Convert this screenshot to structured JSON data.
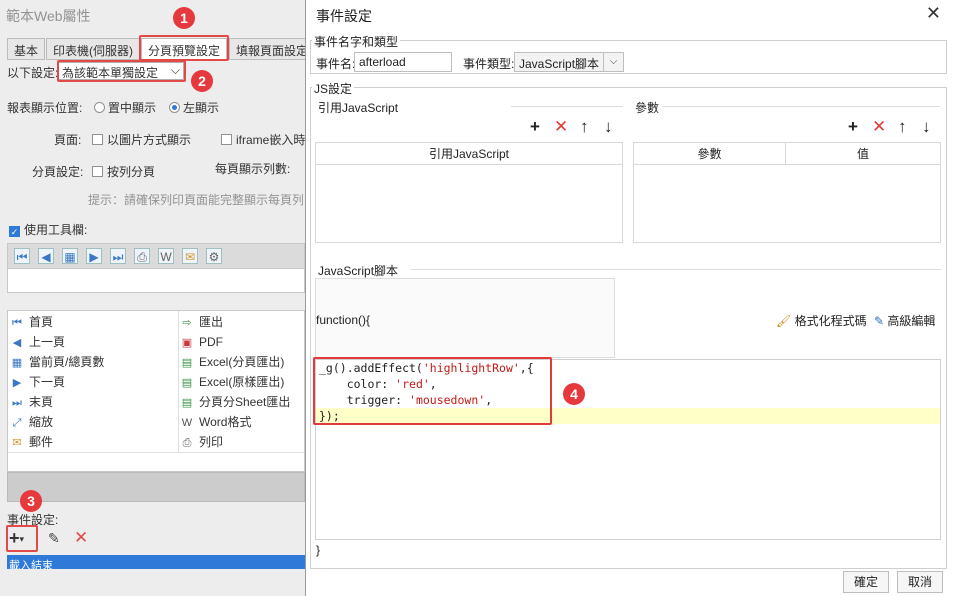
{
  "bg_window": {
    "title": "範本Web屬性",
    "tabs": [
      "基本",
      "印表機(伺服器)",
      "分頁預覽設定",
      "填報頁面設定"
    ],
    "settings_label": "以下設定:",
    "settings_value": "為該範本單獨設定",
    "report_position_label": "報表顯示位置:",
    "pos_center": "置中顯示",
    "pos_left": "左顯示",
    "page_label": "頁面:",
    "page_image_option": "以圖片方式顯示",
    "page_iframe_option": "iframe嵌入時",
    "paging_label": "分頁設定:",
    "paging_by_column": "按列分頁",
    "rows_per_page_label": "每頁顯示列數:",
    "hint": "提示：請確保列印頁面能完整顯示每頁列",
    "use_toolbar_label": "使用工具欄:",
    "toolbar_items_left": [
      "首頁",
      "上一頁",
      "當前頁/總頁數",
      "下一頁",
      "末頁",
      "縮放",
      "郵件"
    ],
    "toolbar_items_right": [
      "匯出",
      "PDF",
      "Excel(分頁匯出)",
      "Excel(原樣匯出)",
      "分頁分Sheet匯出",
      "Word格式",
      "列印"
    ],
    "event_settings_label": "事件設定:",
    "event_list_item": "載入結束"
  },
  "badges": [
    "1",
    "2",
    "3",
    "4"
  ],
  "dialog": {
    "title": "事件設定",
    "event_name_group": "事件名字和類型",
    "event_name_label": "事件名:",
    "event_name_value": "afterload",
    "event_type_label": "事件類型:",
    "event_type_value": "JavaScript腳本",
    "js_group": "JS設定",
    "ref_js_label": "引用JavaScript",
    "params_label": "參數",
    "ref_js_header": "引用JavaScript",
    "params_header": "參數",
    "value_header": "值",
    "script_label": "JavaScript腳本",
    "function_open": "function(){",
    "format_code": "格式化程式碼",
    "advanced_edit": "高級編輯",
    "code_line1a": "_g().addEffect(",
    "code_line1b": "'highlightRow'",
    "code_line1c": ",{",
    "code_line2a": "    color: ",
    "code_line2b": "'red'",
    "code_line2c": ",",
    "code_line3a": "    trigger: ",
    "code_line3b": "'mousedown'",
    "code_line3c": ",",
    "code_line4": "});",
    "function_close": "}",
    "ok": "確定",
    "cancel": "取消"
  },
  "colors": {
    "accent_red": "#e03a3a",
    "string_red": "#c41a16",
    "highlight_line": "#ffffc8",
    "selection_blue": "#1e6fd6"
  }
}
